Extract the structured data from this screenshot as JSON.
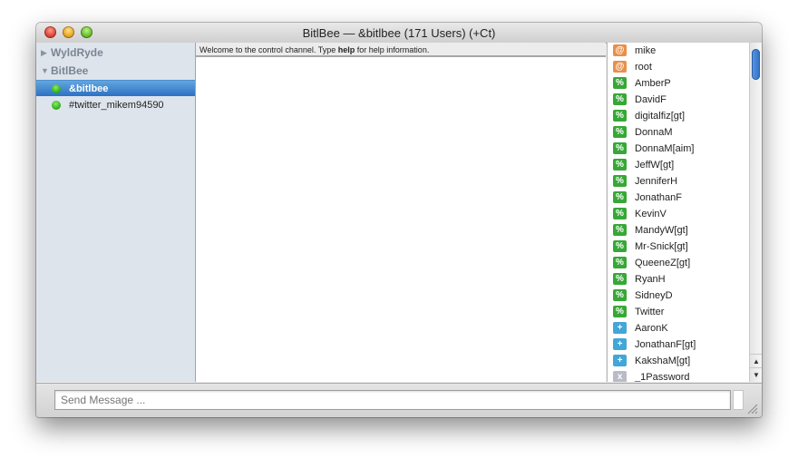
{
  "window": {
    "title": "BitlBee — &bitlbee (171 Users) (+Ct)"
  },
  "sidebar": {
    "groups": [
      {
        "label": "WyldRyde",
        "expanded": false
      },
      {
        "label": "BitlBee",
        "expanded": true
      }
    ],
    "channels": [
      {
        "label": "&bitlbee",
        "selected": true
      },
      {
        "label": "#twitter_mikem94590",
        "selected": false
      }
    ]
  },
  "chat": {
    "topic_prefix": "Welcome to the control channel. Type ",
    "topic_bold": "help",
    "topic_suffix": " for help information."
  },
  "userlist": {
    "users": [
      {
        "badge": "@",
        "mode": "op",
        "name": "mike"
      },
      {
        "badge": "@",
        "mode": "op",
        "name": "root"
      },
      {
        "badge": "%",
        "mode": "half",
        "name": "AmberP"
      },
      {
        "badge": "%",
        "mode": "half",
        "name": "DavidF"
      },
      {
        "badge": "%",
        "mode": "half",
        "name": "digitalfiz[gt]"
      },
      {
        "badge": "%",
        "mode": "half",
        "name": "DonnaM"
      },
      {
        "badge": "%",
        "mode": "half",
        "name": "DonnaM[aim]"
      },
      {
        "badge": "%",
        "mode": "half",
        "name": "JeffW[gt]"
      },
      {
        "badge": "%",
        "mode": "half",
        "name": "JenniferH"
      },
      {
        "badge": "%",
        "mode": "half",
        "name": "JonathanF"
      },
      {
        "badge": "%",
        "mode": "half",
        "name": "KevinV"
      },
      {
        "badge": "%",
        "mode": "half",
        "name": "MandyW[gt]"
      },
      {
        "badge": "%",
        "mode": "half",
        "name": "Mr-Snick[gt]"
      },
      {
        "badge": "%",
        "mode": "half",
        "name": "QueeneZ[gt]"
      },
      {
        "badge": "%",
        "mode": "half",
        "name": "RyanH"
      },
      {
        "badge": "%",
        "mode": "half",
        "name": "SidneyD"
      },
      {
        "badge": "%",
        "mode": "half",
        "name": "Twitter"
      },
      {
        "badge": "+",
        "mode": "voice",
        "name": "AaronK"
      },
      {
        "badge": "+",
        "mode": "voice",
        "name": "JonathanF[gt]"
      },
      {
        "badge": "+",
        "mode": "voice",
        "name": "KakshaM[gt]"
      },
      {
        "badge": "x",
        "mode": "none",
        "name": "_1Password"
      }
    ]
  },
  "composer": {
    "placeholder": "Send Message ..."
  },
  "colors": {
    "op_badge": "#e8904a",
    "halfop_badge": "#36a836",
    "voice_badge": "#42a6d8",
    "none_badge": "#b9bcc6",
    "selection": "#3a7fcf",
    "online": "#35b51d"
  }
}
